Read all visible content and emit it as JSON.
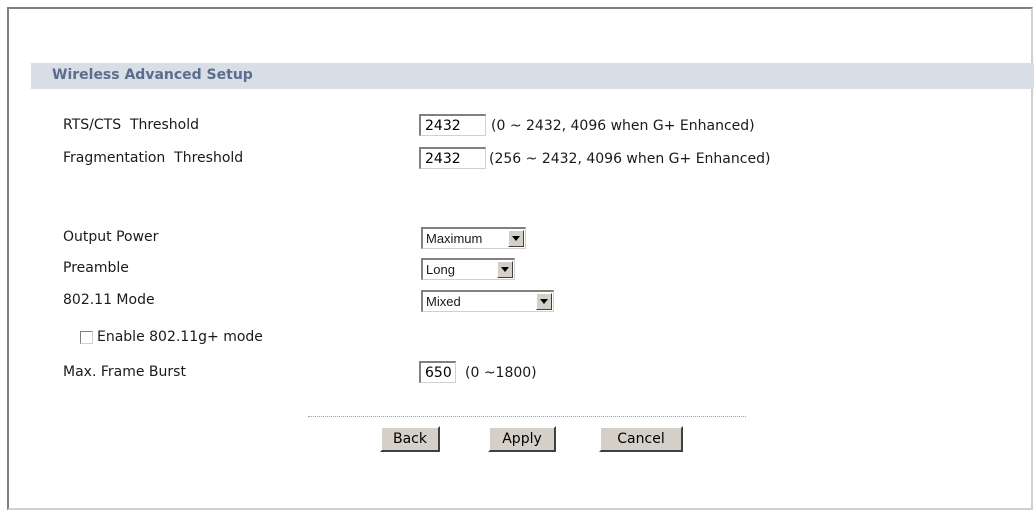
{
  "section": {
    "title": "Wireless Advanced Setup"
  },
  "rts": {
    "label": "RTS/CTS  Threshold",
    "value": "2432",
    "range": "(0 ~ 2432, 4096 when G+ Enhanced)"
  },
  "fragmentation": {
    "label": "Fragmentation  Threshold",
    "value": "2432",
    "range": "(256 ~ 2432, 4096 when G+ Enhanced)"
  },
  "output_power": {
    "label": "Output Power",
    "selected": "Maximum"
  },
  "preamble": {
    "label": "Preamble",
    "selected": "Long"
  },
  "mode": {
    "label": "802.11 Mode",
    "selected": "Mixed"
  },
  "gplus": {
    "label": "Enable 802.11g+ mode",
    "checked": false
  },
  "frame_burst": {
    "label": "Max. Frame Burst",
    "value": "650",
    "range": "(0 ~1800)"
  },
  "buttons": {
    "back": "Back",
    "apply": "Apply",
    "cancel": "Cancel"
  }
}
